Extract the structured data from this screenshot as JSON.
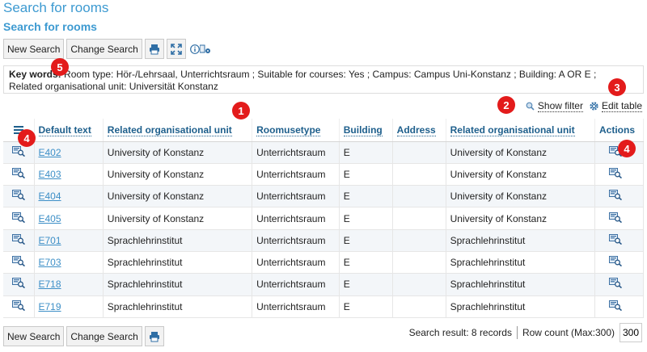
{
  "page": {
    "title": "Search for rooms",
    "section_title": "Search for rooms"
  },
  "toolbar": {
    "new_search": "New Search",
    "change_search": "Change Search"
  },
  "keywords": {
    "label": "Key words:",
    "text": " Room type: Hör-/Lehrsaal, Unterrichtsraum ;  Suitable for courses: Yes ;  Campus: Campus Uni-Konstanz ;  Building: A OR E ;",
    "line2": "Related organisational unit: Universität Konstanz"
  },
  "filter_links": {
    "show_filter": "Show filter",
    "edit_table": "Edit table"
  },
  "table": {
    "headers": [
      "Default text",
      "Related organisational unit",
      "Roomusetype",
      "Building",
      "Address",
      "Related organisational unit",
      "Actions"
    ],
    "rows": [
      [
        "E402",
        "University of Konstanz",
        "Unterrichtsraum",
        "E",
        "",
        "University of Konstanz"
      ],
      [
        "E403",
        "University of Konstanz",
        "Unterrichtsraum",
        "E",
        "",
        "University of Konstanz"
      ],
      [
        "E404",
        "University of Konstanz",
        "Unterrichtsraum",
        "E",
        "",
        "University of Konstanz"
      ],
      [
        "E405",
        "University of Konstanz",
        "Unterrichtsraum",
        "E",
        "",
        "University of Konstanz"
      ],
      [
        "E701",
        "Sprachlehrinstitut",
        "Unterrichtsraum",
        "E",
        "",
        "Sprachlehrinstitut"
      ],
      [
        "E703",
        "Sprachlehrinstitut",
        "Unterrichtsraum",
        "E",
        "",
        "Sprachlehrinstitut"
      ],
      [
        "E718",
        "Sprachlehrinstitut",
        "Unterrichtsraum",
        "E",
        "",
        "Sprachlehrinstitut"
      ],
      [
        "E719",
        "Sprachlehrinstitut",
        "Unterrichtsraum",
        "E",
        "",
        "Sprachlehrinstitut"
      ]
    ]
  },
  "status": {
    "result": "Search result: 8 records",
    "row_count_label": "Row count (Max:300)",
    "row_count_value": "300"
  },
  "badges": [
    "1",
    "2",
    "3",
    "4",
    "4",
    "5"
  ],
  "colors": {
    "accent": "#3d9ad1",
    "header_text": "#1e5f8c",
    "badge": "#e31b1b"
  },
  "icons": [
    "print-icon",
    "fullscreen-icon",
    "info-icon",
    "settings-icon",
    "search-icon",
    "gear-icon",
    "menu-icon",
    "room-details-icon"
  ]
}
